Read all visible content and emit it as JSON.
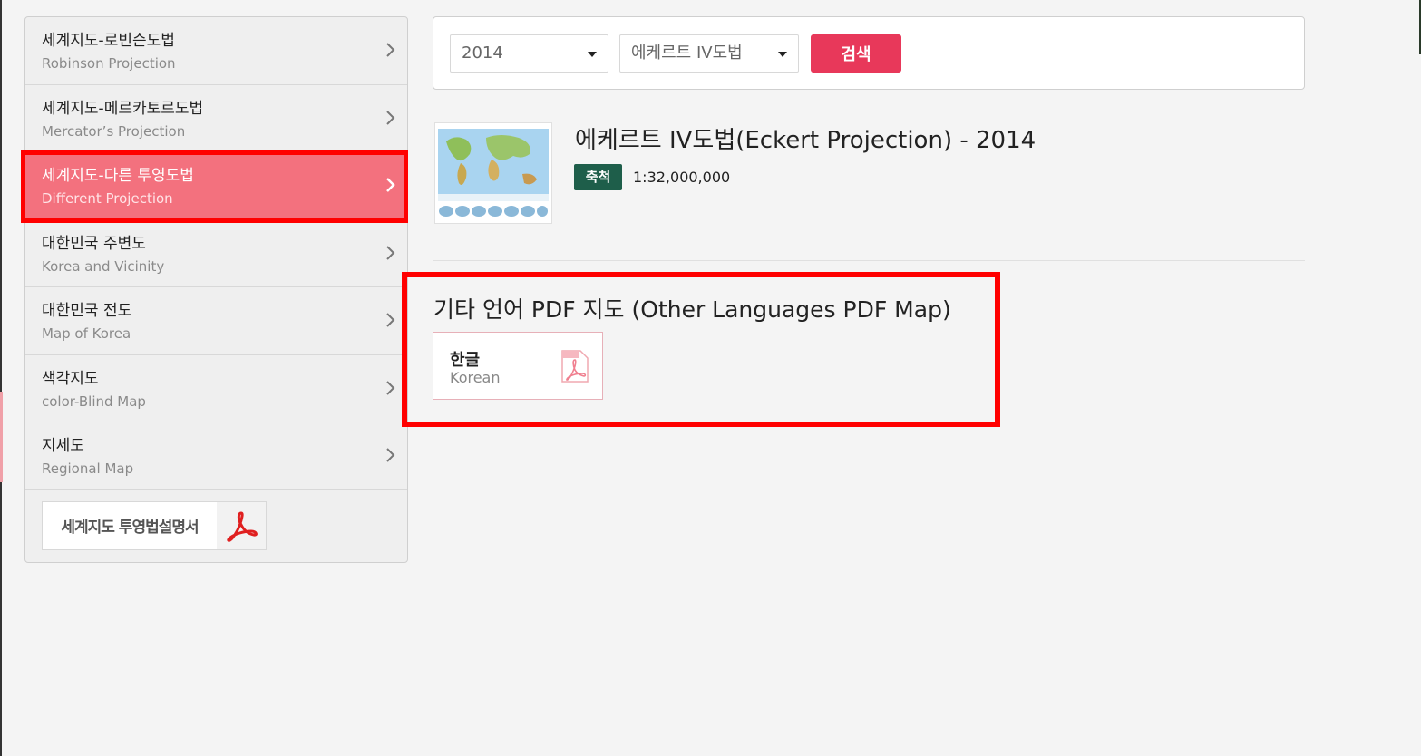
{
  "sidebar": {
    "items": [
      {
        "ko": "세계지도-로빈슨도법",
        "en": "Robinson Projection",
        "active": false
      },
      {
        "ko": "세계지도-메르카토르도법",
        "en": "Mercator’s Projection",
        "active": false
      },
      {
        "ko": "세계지도-다른 투영도법",
        "en": "Different Projection",
        "active": true
      },
      {
        "ko": "대한민국 주변도",
        "en": "Korea and Vicinity",
        "active": false
      },
      {
        "ko": "대한민국 전도",
        "en": "Map of Korea",
        "active": false
      },
      {
        "ko": "색각지도",
        "en": "color-Blind Map",
        "active": false
      },
      {
        "ko": "지세도",
        "en": "Regional Map",
        "active": false
      }
    ],
    "pdf_button_label": "세계지도 투영법설명서"
  },
  "search": {
    "year_value": "2014",
    "projection_value": "에케르트 IV도법",
    "search_label": "검색"
  },
  "result": {
    "title": "에케르트 IV도법(Eckert Projection) - 2014",
    "scale_badge": "축척",
    "scale_value": "1:32,000,000"
  },
  "other_languages": {
    "title": "기타 언어 PDF 지도 (Other Languages PDF Map)",
    "items": [
      {
        "ko": "한글",
        "en": "Korean"
      }
    ]
  },
  "colors": {
    "accent_active": "#f3717e",
    "search_button": "#e8385a",
    "scale_badge": "#1e5e4a",
    "highlight": "#ff0000"
  }
}
